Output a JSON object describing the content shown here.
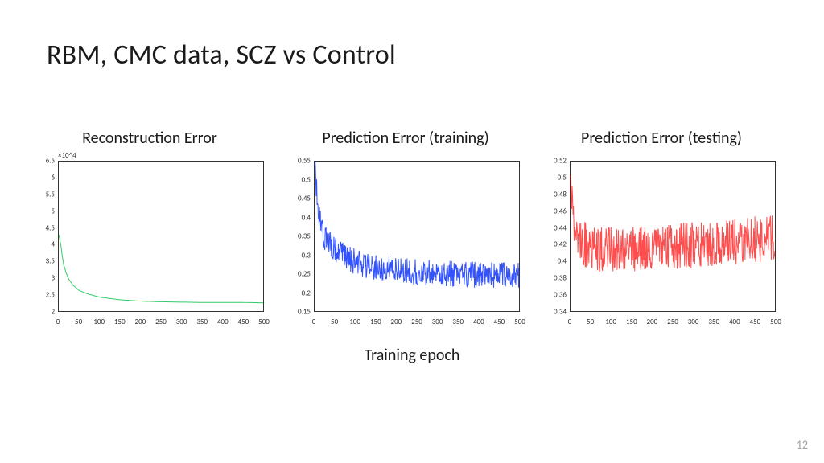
{
  "title": "RBM, CMC data, SCZ vs Control",
  "xaxis_label": "Training epoch",
  "page_number": "12",
  "panels": [
    {
      "title": "Reconstruction Error"
    },
    {
      "title": "Prediction Error (training)"
    },
    {
      "title": "Prediction Error (testing)"
    }
  ],
  "chart_data": [
    {
      "type": "line",
      "title": "Reconstruction Error",
      "xlabel": "Training epoch",
      "ylabel": "",
      "color": "#33cc66",
      "xlim": [
        0,
        500
      ],
      "ylim": [
        2.0,
        6.5
      ],
      "y_scale_exponent": "×10^4",
      "yticks": [
        2,
        2.5,
        3,
        3.5,
        4,
        4.5,
        5,
        5.5,
        6,
        6.5
      ],
      "xticks": [
        0,
        50,
        100,
        150,
        200,
        250,
        300,
        350,
        400,
        450,
        500
      ],
      "noise": 0.0,
      "series": [
        {
          "name": "reconstruction_error",
          "x_points": [
            0,
            2,
            5,
            8,
            12,
            18,
            25,
            35,
            50,
            70,
            100,
            150,
            200,
            250,
            300,
            350,
            400,
            450,
            500
          ],
          "y_points": [
            4.3,
            4.2,
            4.0,
            3.7,
            3.4,
            3.15,
            2.95,
            2.78,
            2.62,
            2.52,
            2.42,
            2.34,
            2.3,
            2.28,
            2.27,
            2.26,
            2.26,
            2.26,
            2.25
          ]
        }
      ]
    },
    {
      "type": "line",
      "title": "Prediction Error (training)",
      "xlabel": "Training epoch",
      "ylabel": "",
      "color": "#3352ff",
      "xlim": [
        0,
        500
      ],
      "ylim": [
        0.15,
        0.55
      ],
      "yticks": [
        0.15,
        0.2,
        0.25,
        0.3,
        0.35,
        0.4,
        0.45,
        0.5,
        0.55
      ],
      "xticks": [
        0,
        50,
        100,
        150,
        200,
        250,
        300,
        350,
        400,
        450,
        500
      ],
      "noise": 0.035,
      "series": [
        {
          "name": "train_pred_error",
          "x_points": [
            0,
            3,
            6,
            10,
            15,
            25,
            40,
            60,
            90,
            130,
            180,
            240,
            300,
            360,
            420,
            500
          ],
          "y_points": [
            0.535,
            0.5,
            0.46,
            0.42,
            0.38,
            0.345,
            0.325,
            0.305,
            0.285,
            0.272,
            0.262,
            0.255,
            0.25,
            0.248,
            0.246,
            0.245
          ]
        }
      ]
    },
    {
      "type": "line",
      "title": "Prediction Error (testing)",
      "xlabel": "Training epoch",
      "ylabel": "",
      "color": "#ff4d4d",
      "xlim": [
        0,
        500
      ],
      "ylim": [
        0.34,
        0.52
      ],
      "yticks": [
        0.34,
        0.36,
        0.38,
        0.4,
        0.42,
        0.44,
        0.46,
        0.48,
        0.5,
        0.52
      ],
      "xticks": [
        0,
        50,
        100,
        150,
        200,
        250,
        300,
        350,
        400,
        450,
        500
      ],
      "noise": 0.028,
      "series": [
        {
          "name": "test_pred_error",
          "x_points": [
            0,
            5,
            20,
            50,
            100,
            180,
            260,
            340,
            420,
            500
          ],
          "y_points": [
            0.5,
            0.46,
            0.425,
            0.415,
            0.414,
            0.414,
            0.418,
            0.421,
            0.425,
            0.428
          ]
        }
      ]
    }
  ]
}
